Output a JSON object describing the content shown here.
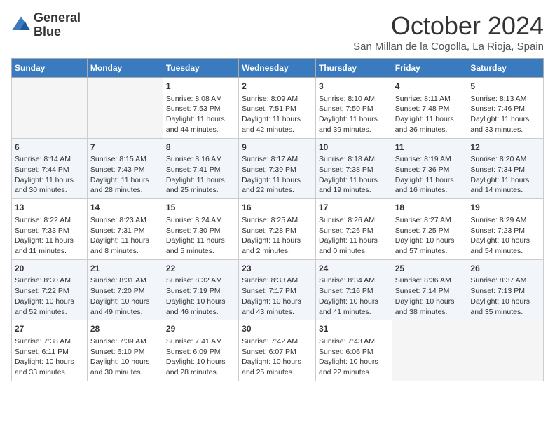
{
  "header": {
    "logo_line1": "General",
    "logo_line2": "Blue",
    "month": "October 2024",
    "location": "San Millan de la Cogolla, La Rioja, Spain"
  },
  "days_of_week": [
    "Sunday",
    "Monday",
    "Tuesday",
    "Wednesday",
    "Thursday",
    "Friday",
    "Saturday"
  ],
  "weeks": [
    [
      {
        "day": "",
        "sunrise": "",
        "sunset": "",
        "daylight": ""
      },
      {
        "day": "",
        "sunrise": "",
        "sunset": "",
        "daylight": ""
      },
      {
        "day": "1",
        "sunrise": "Sunrise: 8:08 AM",
        "sunset": "Sunset: 7:53 PM",
        "daylight": "Daylight: 11 hours and 44 minutes."
      },
      {
        "day": "2",
        "sunrise": "Sunrise: 8:09 AM",
        "sunset": "Sunset: 7:51 PM",
        "daylight": "Daylight: 11 hours and 42 minutes."
      },
      {
        "day": "3",
        "sunrise": "Sunrise: 8:10 AM",
        "sunset": "Sunset: 7:50 PM",
        "daylight": "Daylight: 11 hours and 39 minutes."
      },
      {
        "day": "4",
        "sunrise": "Sunrise: 8:11 AM",
        "sunset": "Sunset: 7:48 PM",
        "daylight": "Daylight: 11 hours and 36 minutes."
      },
      {
        "day": "5",
        "sunrise": "Sunrise: 8:13 AM",
        "sunset": "Sunset: 7:46 PM",
        "daylight": "Daylight: 11 hours and 33 minutes."
      }
    ],
    [
      {
        "day": "6",
        "sunrise": "Sunrise: 8:14 AM",
        "sunset": "Sunset: 7:44 PM",
        "daylight": "Daylight: 11 hours and 30 minutes."
      },
      {
        "day": "7",
        "sunrise": "Sunrise: 8:15 AM",
        "sunset": "Sunset: 7:43 PM",
        "daylight": "Daylight: 11 hours and 28 minutes."
      },
      {
        "day": "8",
        "sunrise": "Sunrise: 8:16 AM",
        "sunset": "Sunset: 7:41 PM",
        "daylight": "Daylight: 11 hours and 25 minutes."
      },
      {
        "day": "9",
        "sunrise": "Sunrise: 8:17 AM",
        "sunset": "Sunset: 7:39 PM",
        "daylight": "Daylight: 11 hours and 22 minutes."
      },
      {
        "day": "10",
        "sunrise": "Sunrise: 8:18 AM",
        "sunset": "Sunset: 7:38 PM",
        "daylight": "Daylight: 11 hours and 19 minutes."
      },
      {
        "day": "11",
        "sunrise": "Sunrise: 8:19 AM",
        "sunset": "Sunset: 7:36 PM",
        "daylight": "Daylight: 11 hours and 16 minutes."
      },
      {
        "day": "12",
        "sunrise": "Sunrise: 8:20 AM",
        "sunset": "Sunset: 7:34 PM",
        "daylight": "Daylight: 11 hours and 14 minutes."
      }
    ],
    [
      {
        "day": "13",
        "sunrise": "Sunrise: 8:22 AM",
        "sunset": "Sunset: 7:33 PM",
        "daylight": "Daylight: 11 hours and 11 minutes."
      },
      {
        "day": "14",
        "sunrise": "Sunrise: 8:23 AM",
        "sunset": "Sunset: 7:31 PM",
        "daylight": "Daylight: 11 hours and 8 minutes."
      },
      {
        "day": "15",
        "sunrise": "Sunrise: 8:24 AM",
        "sunset": "Sunset: 7:30 PM",
        "daylight": "Daylight: 11 hours and 5 minutes."
      },
      {
        "day": "16",
        "sunrise": "Sunrise: 8:25 AM",
        "sunset": "Sunset: 7:28 PM",
        "daylight": "Daylight: 11 hours and 2 minutes."
      },
      {
        "day": "17",
        "sunrise": "Sunrise: 8:26 AM",
        "sunset": "Sunset: 7:26 PM",
        "daylight": "Daylight: 11 hours and 0 minutes."
      },
      {
        "day": "18",
        "sunrise": "Sunrise: 8:27 AM",
        "sunset": "Sunset: 7:25 PM",
        "daylight": "Daylight: 10 hours and 57 minutes."
      },
      {
        "day": "19",
        "sunrise": "Sunrise: 8:29 AM",
        "sunset": "Sunset: 7:23 PM",
        "daylight": "Daylight: 10 hours and 54 minutes."
      }
    ],
    [
      {
        "day": "20",
        "sunrise": "Sunrise: 8:30 AM",
        "sunset": "Sunset: 7:22 PM",
        "daylight": "Daylight: 10 hours and 52 minutes."
      },
      {
        "day": "21",
        "sunrise": "Sunrise: 8:31 AM",
        "sunset": "Sunset: 7:20 PM",
        "daylight": "Daylight: 10 hours and 49 minutes."
      },
      {
        "day": "22",
        "sunrise": "Sunrise: 8:32 AM",
        "sunset": "Sunset: 7:19 PM",
        "daylight": "Daylight: 10 hours and 46 minutes."
      },
      {
        "day": "23",
        "sunrise": "Sunrise: 8:33 AM",
        "sunset": "Sunset: 7:17 PM",
        "daylight": "Daylight: 10 hours and 43 minutes."
      },
      {
        "day": "24",
        "sunrise": "Sunrise: 8:34 AM",
        "sunset": "Sunset: 7:16 PM",
        "daylight": "Daylight: 10 hours and 41 minutes."
      },
      {
        "day": "25",
        "sunrise": "Sunrise: 8:36 AM",
        "sunset": "Sunset: 7:14 PM",
        "daylight": "Daylight: 10 hours and 38 minutes."
      },
      {
        "day": "26",
        "sunrise": "Sunrise: 8:37 AM",
        "sunset": "Sunset: 7:13 PM",
        "daylight": "Daylight: 10 hours and 35 minutes."
      }
    ],
    [
      {
        "day": "27",
        "sunrise": "Sunrise: 7:38 AM",
        "sunset": "Sunset: 6:11 PM",
        "daylight": "Daylight: 10 hours and 33 minutes."
      },
      {
        "day": "28",
        "sunrise": "Sunrise: 7:39 AM",
        "sunset": "Sunset: 6:10 PM",
        "daylight": "Daylight: 10 hours and 30 minutes."
      },
      {
        "day": "29",
        "sunrise": "Sunrise: 7:41 AM",
        "sunset": "Sunset: 6:09 PM",
        "daylight": "Daylight: 10 hours and 28 minutes."
      },
      {
        "day": "30",
        "sunrise": "Sunrise: 7:42 AM",
        "sunset": "Sunset: 6:07 PM",
        "daylight": "Daylight: 10 hours and 25 minutes."
      },
      {
        "day": "31",
        "sunrise": "Sunrise: 7:43 AM",
        "sunset": "Sunset: 6:06 PM",
        "daylight": "Daylight: 10 hours and 22 minutes."
      },
      {
        "day": "",
        "sunrise": "",
        "sunset": "",
        "daylight": ""
      },
      {
        "day": "",
        "sunrise": "",
        "sunset": "",
        "daylight": ""
      }
    ]
  ]
}
